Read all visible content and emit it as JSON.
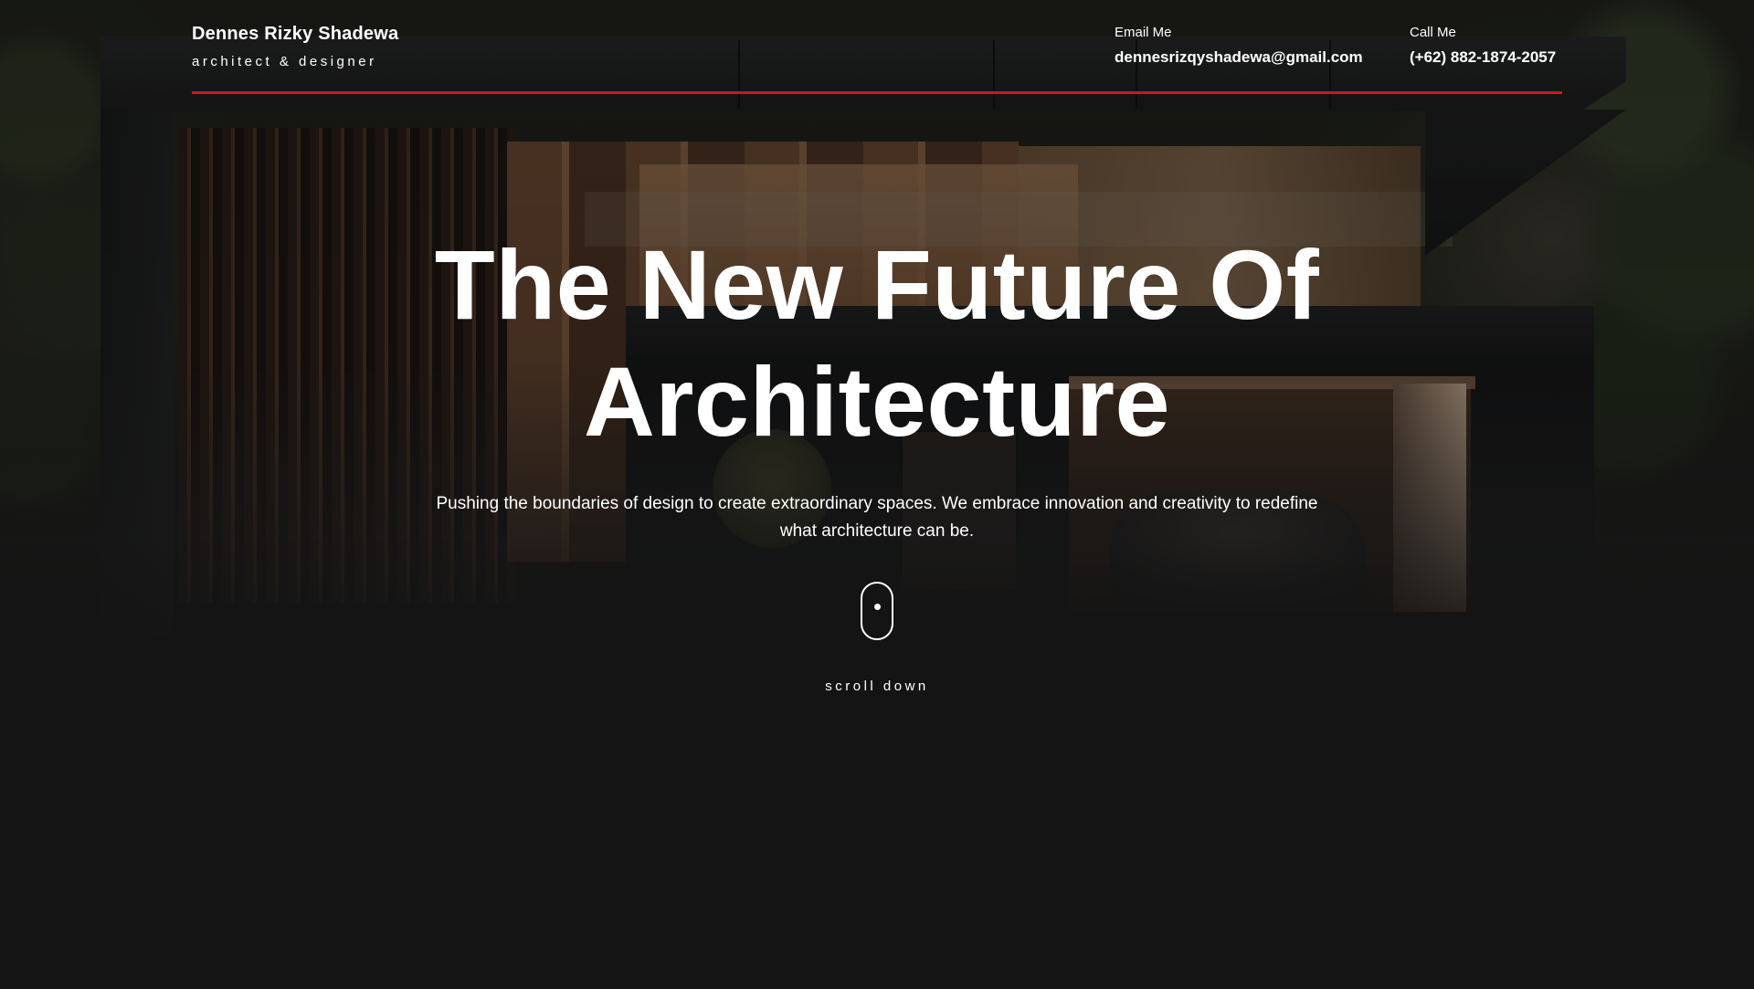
{
  "header": {
    "brand_name": "Dennes Rizky Shadewa",
    "brand_tagline": "architect & designer",
    "email_label": "Email Me",
    "email_value": "dennesrizqyshadewa@gmail.com",
    "phone_label": "Call Me",
    "phone_value": "(+62) 882-1874-2057"
  },
  "hero": {
    "title_line1": "The New Future Of",
    "title_line2": "Architecture",
    "subtitle": "Pushing the boundaries of design to create extraordinary spaces. We embrace innovation and creativity to redefine what architecture can be.",
    "scroll_label": "scroll down",
    "scroll_icon": "mouse-scroll-icon"
  },
  "colors": {
    "accent_rule": "#d3141a",
    "page_background": "#141414",
    "text": "#ffffff"
  }
}
